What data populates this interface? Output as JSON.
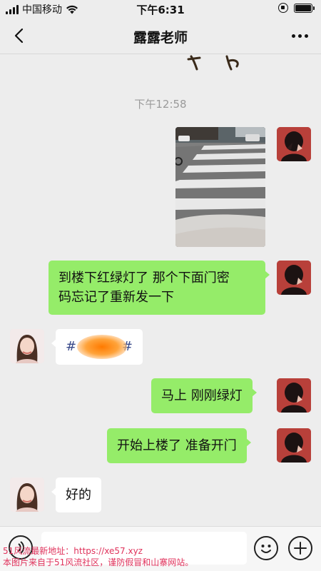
{
  "status_bar": {
    "carrier": "中国移动",
    "time": "下午6:31"
  },
  "header": {
    "title": "露露老师"
  },
  "chat": {
    "timestamp": "下午12:58",
    "messages": [
      {
        "sender": "self",
        "type": "image"
      },
      {
        "sender": "self",
        "type": "text",
        "lines": [
          "到楼下红绿灯了 那个下面门密",
          "码忘记了重新发一下"
        ]
      },
      {
        "sender": "other",
        "type": "text",
        "text": "#",
        "text_end": "#",
        "note_visible": "blurred"
      },
      {
        "sender": "self",
        "type": "text",
        "text": "马上 刚刚绿灯"
      },
      {
        "sender": "self",
        "type": "text",
        "text": "开始上楼了 准备开门"
      },
      {
        "sender": "other",
        "type": "text",
        "text": "好的"
      }
    ]
  },
  "watermark": {
    "line1": "51风流最新地址：https://xe57.xyz",
    "line2": "本图片来自于51风流社区，谨防假冒和山寨网站。"
  },
  "colors": {
    "self_bubble": "#95ec69",
    "other_bubble": "#ffffff",
    "background": "#ededed",
    "watermark": "#e0335c"
  },
  "icons": [
    "back-icon",
    "more-icon",
    "voice-icon",
    "emoji-icon",
    "plus-icon",
    "wifi-icon",
    "battery-icon"
  ]
}
